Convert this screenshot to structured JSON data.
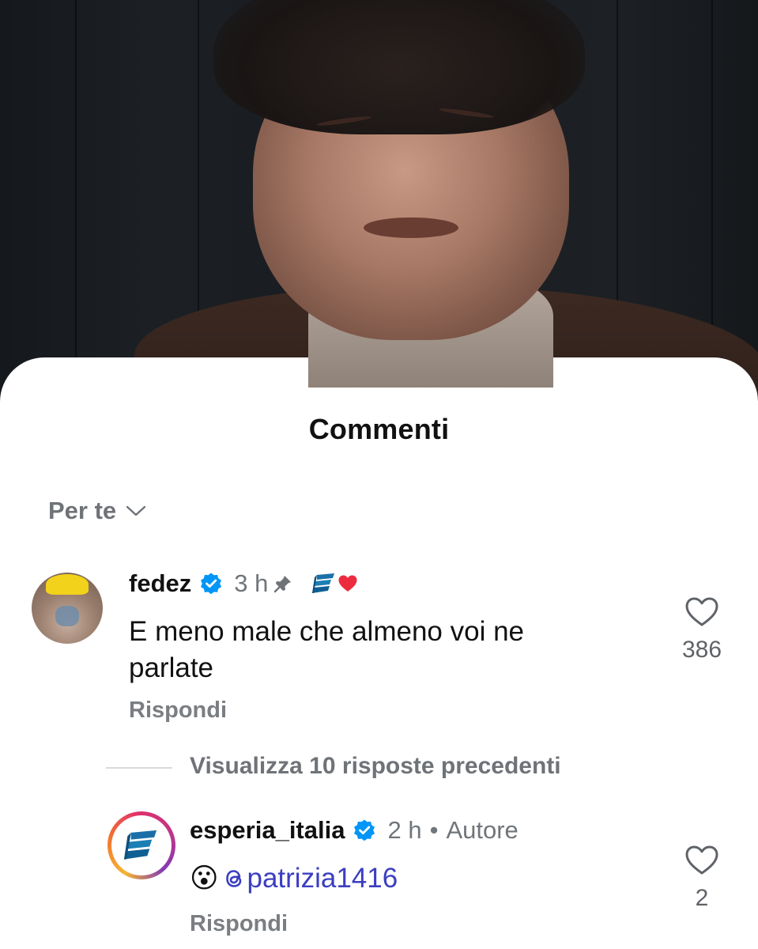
{
  "sheet": {
    "title": "Commenti",
    "sort_label": "Per te"
  },
  "comments": [
    {
      "username": "fedez",
      "time": "3 h",
      "text_line1": "E meno male che almeno voi ne",
      "text_line2": "parlate",
      "reply_label": "Rispondi",
      "likes": "386"
    }
  ],
  "thread": {
    "view_replies_label": "Visualizza 10 risposte precedenti"
  },
  "reply": {
    "username": "esperia_italia",
    "time": "2 h",
    "separator": "•",
    "author_label": "Autore",
    "emoji": "😮",
    "mention": "patrizia1416",
    "reply_label": "Rispondi",
    "likes": "2"
  },
  "colors": {
    "verified": "#0095f6",
    "heart": "#ed2b3f",
    "brand": "#1b6fa8",
    "mention": "#3b3ec0"
  },
  "icons": [
    "chevron-down-icon",
    "verified-badge-icon",
    "pin-icon",
    "esperia-logo-icon",
    "heart-icon",
    "threads-icon"
  ]
}
